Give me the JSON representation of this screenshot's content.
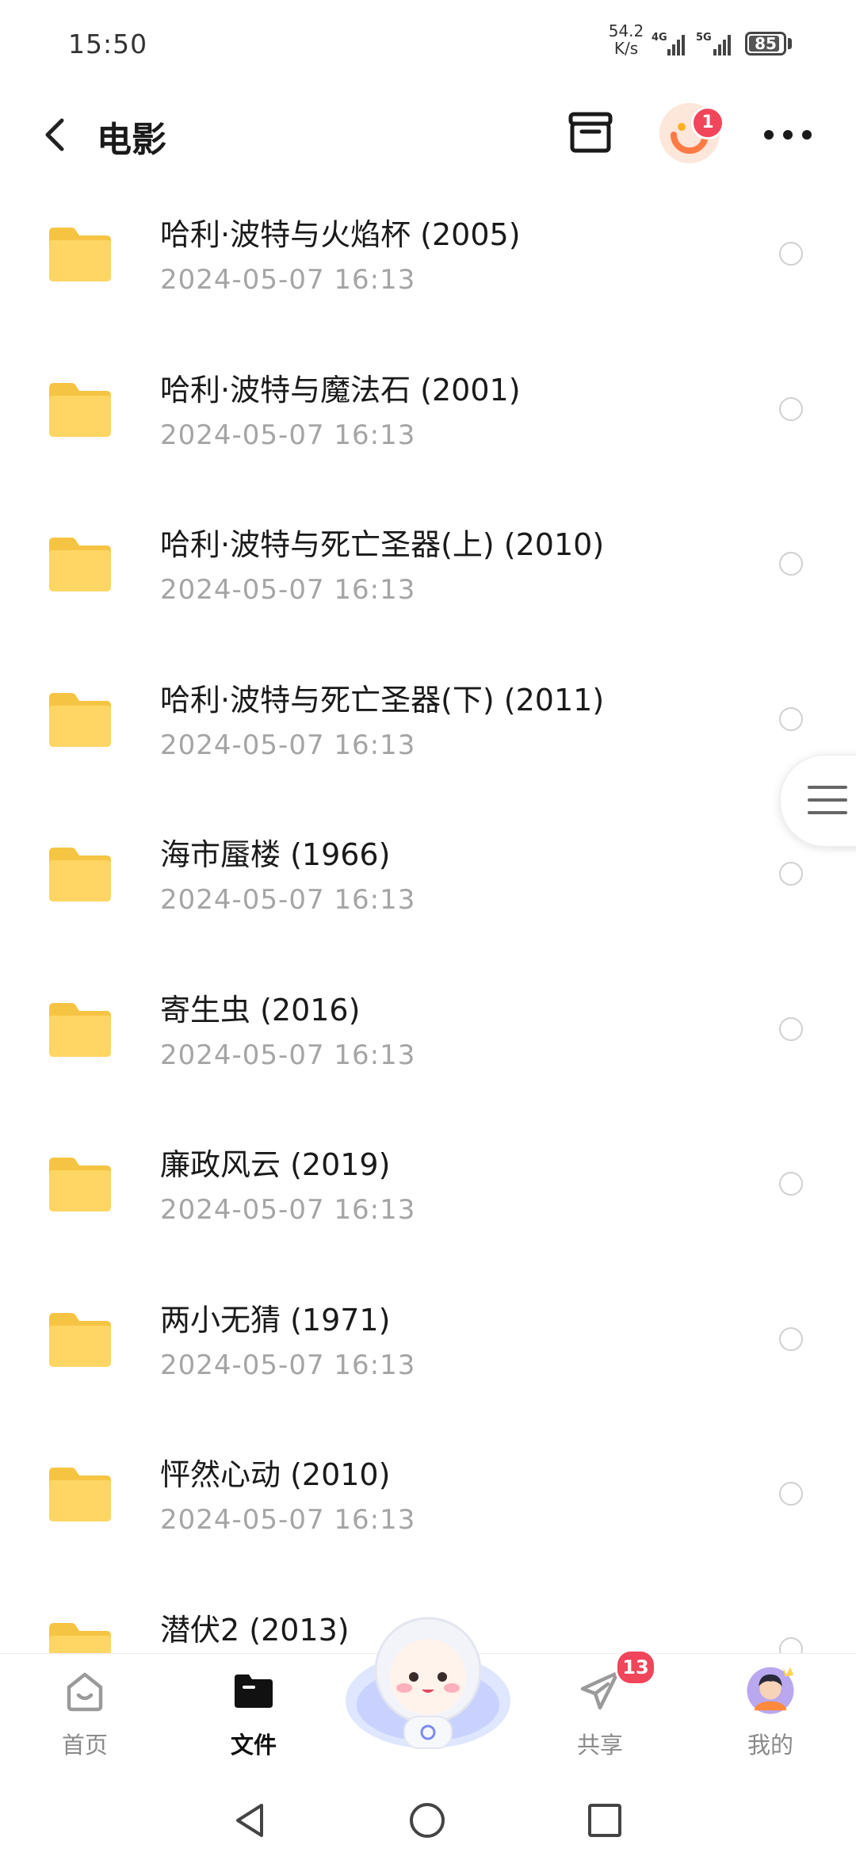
{
  "status_bar": {
    "time": "15:50",
    "net_speed_value": "54.2",
    "net_speed_unit": "K/s",
    "signal1_label": "4G",
    "signal2_label": "5G",
    "battery": "85"
  },
  "header": {
    "title": "电影"
  },
  "header_badge": "1",
  "files": [
    {
      "name": "哈利·波特与火焰杯 (2005)",
      "date": "2024-05-07  16:13"
    },
    {
      "name": "哈利·波特与魔法石 (2001)",
      "date": "2024-05-07  16:13"
    },
    {
      "name": "哈利·波特与死亡圣器(上) (2010)",
      "date": "2024-05-07  16:13"
    },
    {
      "name": "哈利·波特与死亡圣器(下) (2011)",
      "date": "2024-05-07  16:13"
    },
    {
      "name": "海市蜃楼 (1966)",
      "date": "2024-05-07  16:13"
    },
    {
      "name": "寄生虫 (2016)",
      "date": "2024-05-07  16:13"
    },
    {
      "name": "廉政风云 (2019)",
      "date": "2024-05-07  16:13"
    },
    {
      "name": "两小无猜 (1971)",
      "date": "2024-05-07  16:13"
    },
    {
      "name": "怦然心动 (2010)",
      "date": "2024-05-07  16:13"
    },
    {
      "name": "潜伏2 (2013)",
      "date": ""
    }
  ],
  "bottom_nav": {
    "home": "首页",
    "files": "文件",
    "share": "共享",
    "mine": "我的",
    "share_badge": "13"
  },
  "colors": {
    "folder": "#FFD663",
    "folder_tab": "#F6C443",
    "badge": "#F0455A",
    "date_text": "#A5A5A5"
  },
  "icons": {
    "back": "chevron-left-icon",
    "archive": "archive-box-icon",
    "more": "more-dots-icon",
    "folder": "folder-icon",
    "home": "home-icon",
    "files": "files-icon",
    "share": "paper-plane-icon",
    "mine": "user-avatar-icon"
  }
}
